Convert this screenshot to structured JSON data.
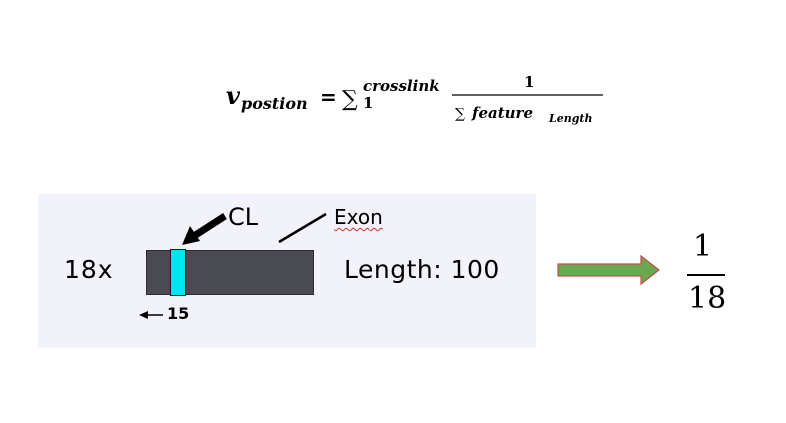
{
  "formula": {
    "v": "v",
    "v_sub": "postion",
    "equals": "=",
    "sigma": "∑",
    "lower": "1",
    "upper": "crosslink",
    "numerator": "1",
    "denominator_sigma": "∑",
    "denominator": "feature",
    "denominator_sub": "Length"
  },
  "diagram": {
    "count_label": "18x",
    "cl_label": "CL",
    "exon_label": "Exon",
    "length_label": "Length: 100",
    "position_label": "15",
    "exon_color": "#4a4a52",
    "cl_color": "#00e5f0",
    "panel_color": "#f2f2fb"
  },
  "result": {
    "arrow_color": "#6aa84f",
    "arrow_border": "#c0504d",
    "numerator": "1",
    "denominator": "18"
  }
}
